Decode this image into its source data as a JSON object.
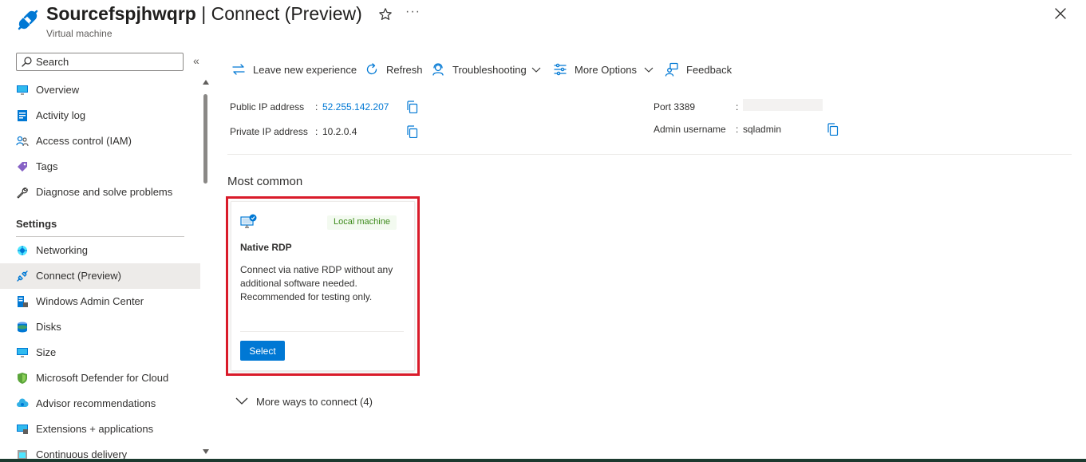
{
  "header": {
    "resource_name": "Sourcefspjhwqrp",
    "page_title": " | Connect (Preview)",
    "subtitle": "Virtual machine",
    "more_actions": "···"
  },
  "sidebar": {
    "search_placeholder": "Search",
    "collapse_glyph": "«",
    "items_top": [
      {
        "label": "Overview",
        "icon": "monitor-icon"
      },
      {
        "label": "Activity log",
        "icon": "activity-log-icon"
      },
      {
        "label": "Access control (IAM)",
        "icon": "iam-people-icon"
      },
      {
        "label": "Tags",
        "icon": "tag-icon"
      },
      {
        "label": "Diagnose and solve problems",
        "icon": "wrench-icon"
      }
    ],
    "settings_label": "Settings",
    "items_settings": [
      {
        "label": "Networking",
        "icon": "networking-icon"
      },
      {
        "label": "Connect (Preview)",
        "icon": "connect-plug-icon",
        "active": true
      },
      {
        "label": "Windows Admin Center",
        "icon": "windows-admin-center-icon"
      },
      {
        "label": "Disks",
        "icon": "disk-icon"
      },
      {
        "label": "Size",
        "icon": "size-monitor-icon"
      },
      {
        "label": "Microsoft Defender for Cloud",
        "icon": "shield-icon"
      },
      {
        "label": "Advisor recommendations",
        "icon": "advisor-cloud-icon"
      },
      {
        "label": "Extensions + applications",
        "icon": "extensions-icon"
      },
      {
        "label": "Continuous delivery",
        "icon": "continuous-delivery-icon"
      }
    ]
  },
  "toolbar": {
    "leave_new_experience": "Leave new experience",
    "refresh": "Refresh",
    "troubleshooting": "Troubleshooting",
    "more_options": "More Options",
    "feedback": "Feedback"
  },
  "connection_info": {
    "public_ip_label": "Public IP address",
    "public_ip_value": "52.255.142.207",
    "private_ip_label": "Private IP address",
    "private_ip_value": "10.2.0.4",
    "port_label": "Port 3389",
    "admin_username_label": "Admin username",
    "admin_username_value": "sqladmin",
    "separator": ":"
  },
  "most_common": {
    "heading": "Most common",
    "card": {
      "badge": "Local machine",
      "title": "Native RDP",
      "description": "Connect via native RDP without any additional software needed. Recommended for testing only.",
      "select_label": "Select"
    }
  },
  "more_ways": {
    "label": "More ways to connect (4)"
  },
  "colors": {
    "accent": "#0078d4",
    "highlight": "#d91b2a",
    "badge_green": "#3c8a1a",
    "active_nav_bg": "#edebe9"
  }
}
